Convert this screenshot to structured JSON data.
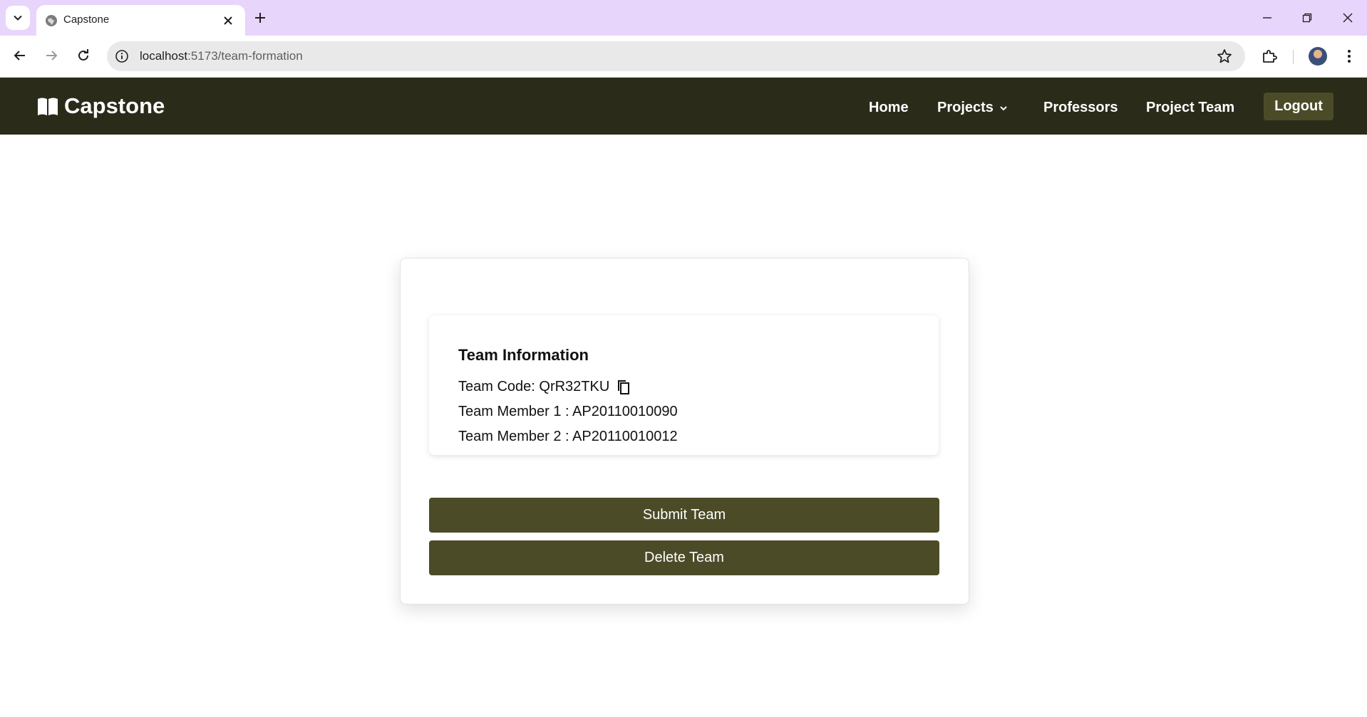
{
  "browser": {
    "tab_title": "Capstone",
    "url_host": "localhost",
    "url_path": ":5173/team-formation"
  },
  "navbar": {
    "brand": "Capstone",
    "links": {
      "home": "Home",
      "projects": "Projects",
      "professors": "Professors",
      "project_team": "Project Team"
    },
    "logout": "Logout"
  },
  "team_info": {
    "title": "Team Information",
    "code_label": "Team Code: QrR32TKU",
    "member_1": "Team Member 1 : AP20110010090",
    "member_2": "Team Member 2 : AP20110010012"
  },
  "actions": {
    "submit": "Submit Team",
    "delete": "Delete Team"
  },
  "colors": {
    "navbar_bg": "#2b2b1a",
    "button_bg": "#4b4b28",
    "tabbar_bg": "#e8d5fb"
  }
}
